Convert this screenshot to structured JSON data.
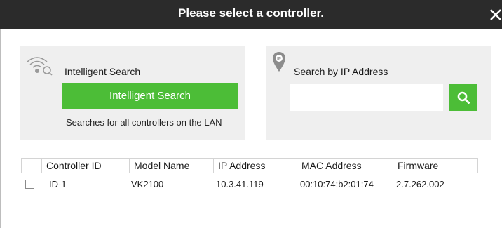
{
  "dialog": {
    "title": "Please select a controller."
  },
  "intelligent_search": {
    "label": "Intelligent Search",
    "button_label": "Intelligent Search",
    "hint": "Searches for all controllers on the LAN",
    "icon": "wifi-search-icon"
  },
  "ip_search": {
    "label": "Search by IP Address",
    "input_value": "",
    "icon": "location-pin-icon",
    "button_icon": "search-icon"
  },
  "table": {
    "columns": [
      "Controller ID",
      "Model Name",
      "IP Address",
      "MAC Address",
      "Firmware"
    ],
    "rows": [
      {
        "checked": false,
        "controller_id": "ID-1",
        "model_name": "VK2100",
        "ip_address": "10.3.41.119",
        "mac_address": "00:10:74:b2:01:74",
        "firmware": "2.7.262.002"
      }
    ]
  },
  "colors": {
    "titlebar": "#2b2b2b",
    "accent_green": "#4cbd37",
    "panel_bg": "#efefef"
  }
}
